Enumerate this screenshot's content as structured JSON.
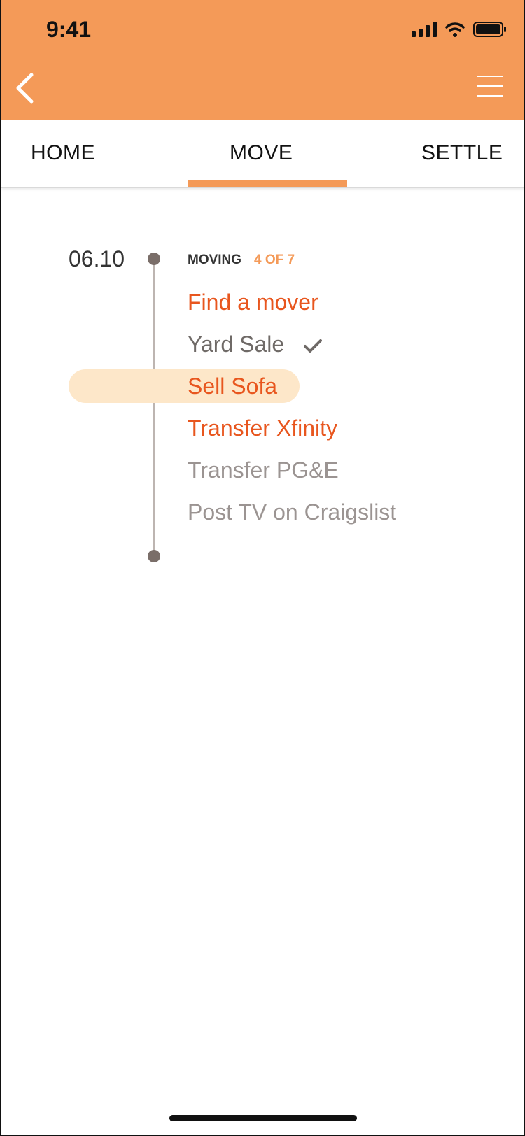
{
  "status_bar": {
    "time": "9:41"
  },
  "tabs": [
    {
      "label": "HOME"
    },
    {
      "label": "MOVE"
    },
    {
      "label": "SETTLE"
    }
  ],
  "timeline": {
    "date": "06.10",
    "group_label": "MOVING",
    "progress": "4 OF  7",
    "tasks": [
      {
        "label": "Find a mover",
        "state": "pending"
      },
      {
        "label": "Yard Sale",
        "state": "completed"
      },
      {
        "label": "Sell Sofa",
        "state": "selected"
      },
      {
        "label": "Transfer Xfinity",
        "state": "pending"
      },
      {
        "label": "Transfer PG&E",
        "state": "inactive"
      },
      {
        "label": "Post TV on Craigslist",
        "state": "inactive"
      }
    ]
  },
  "colors": {
    "brand": "#f49a58",
    "accent_text": "#e8561e",
    "completed_text": "#6f6a67",
    "inactive_text": "#9b9492",
    "highlight": "#fde7c9"
  },
  "icons": [
    "back-chevron-icon",
    "hamburger-menu-icon",
    "signal-icon",
    "wifi-icon",
    "battery-icon",
    "check-icon"
  ]
}
